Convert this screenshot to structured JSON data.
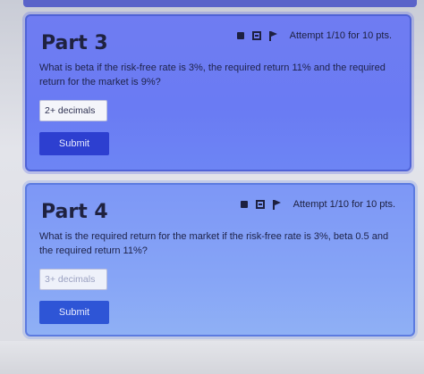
{
  "parts": [
    {
      "title": "Part 3",
      "attempt": "Attempt 1/10 for 10 pts.",
      "question": "What is beta if the risk-free rate is 3%, the required return 11% and the required return for the market is 9%?",
      "answer_placeholder": "2+ decimals",
      "submit_label": "Submit"
    },
    {
      "title": "Part 4",
      "attempt": "Attempt 1/10 for 10 pts.",
      "question": "What is the required return for the market if the risk-free rate is 3%, beta 0.5 and the required return 11%?",
      "answer_placeholder": "3+ decimals",
      "submit_label": "Submit"
    }
  ],
  "icons": [
    "stop-icon",
    "save-icon",
    "flag-icon"
  ],
  "colors": {
    "card_active": "#6a7bf3",
    "card_inactive": "#86a4f6",
    "submit": "#2d3fd0"
  }
}
